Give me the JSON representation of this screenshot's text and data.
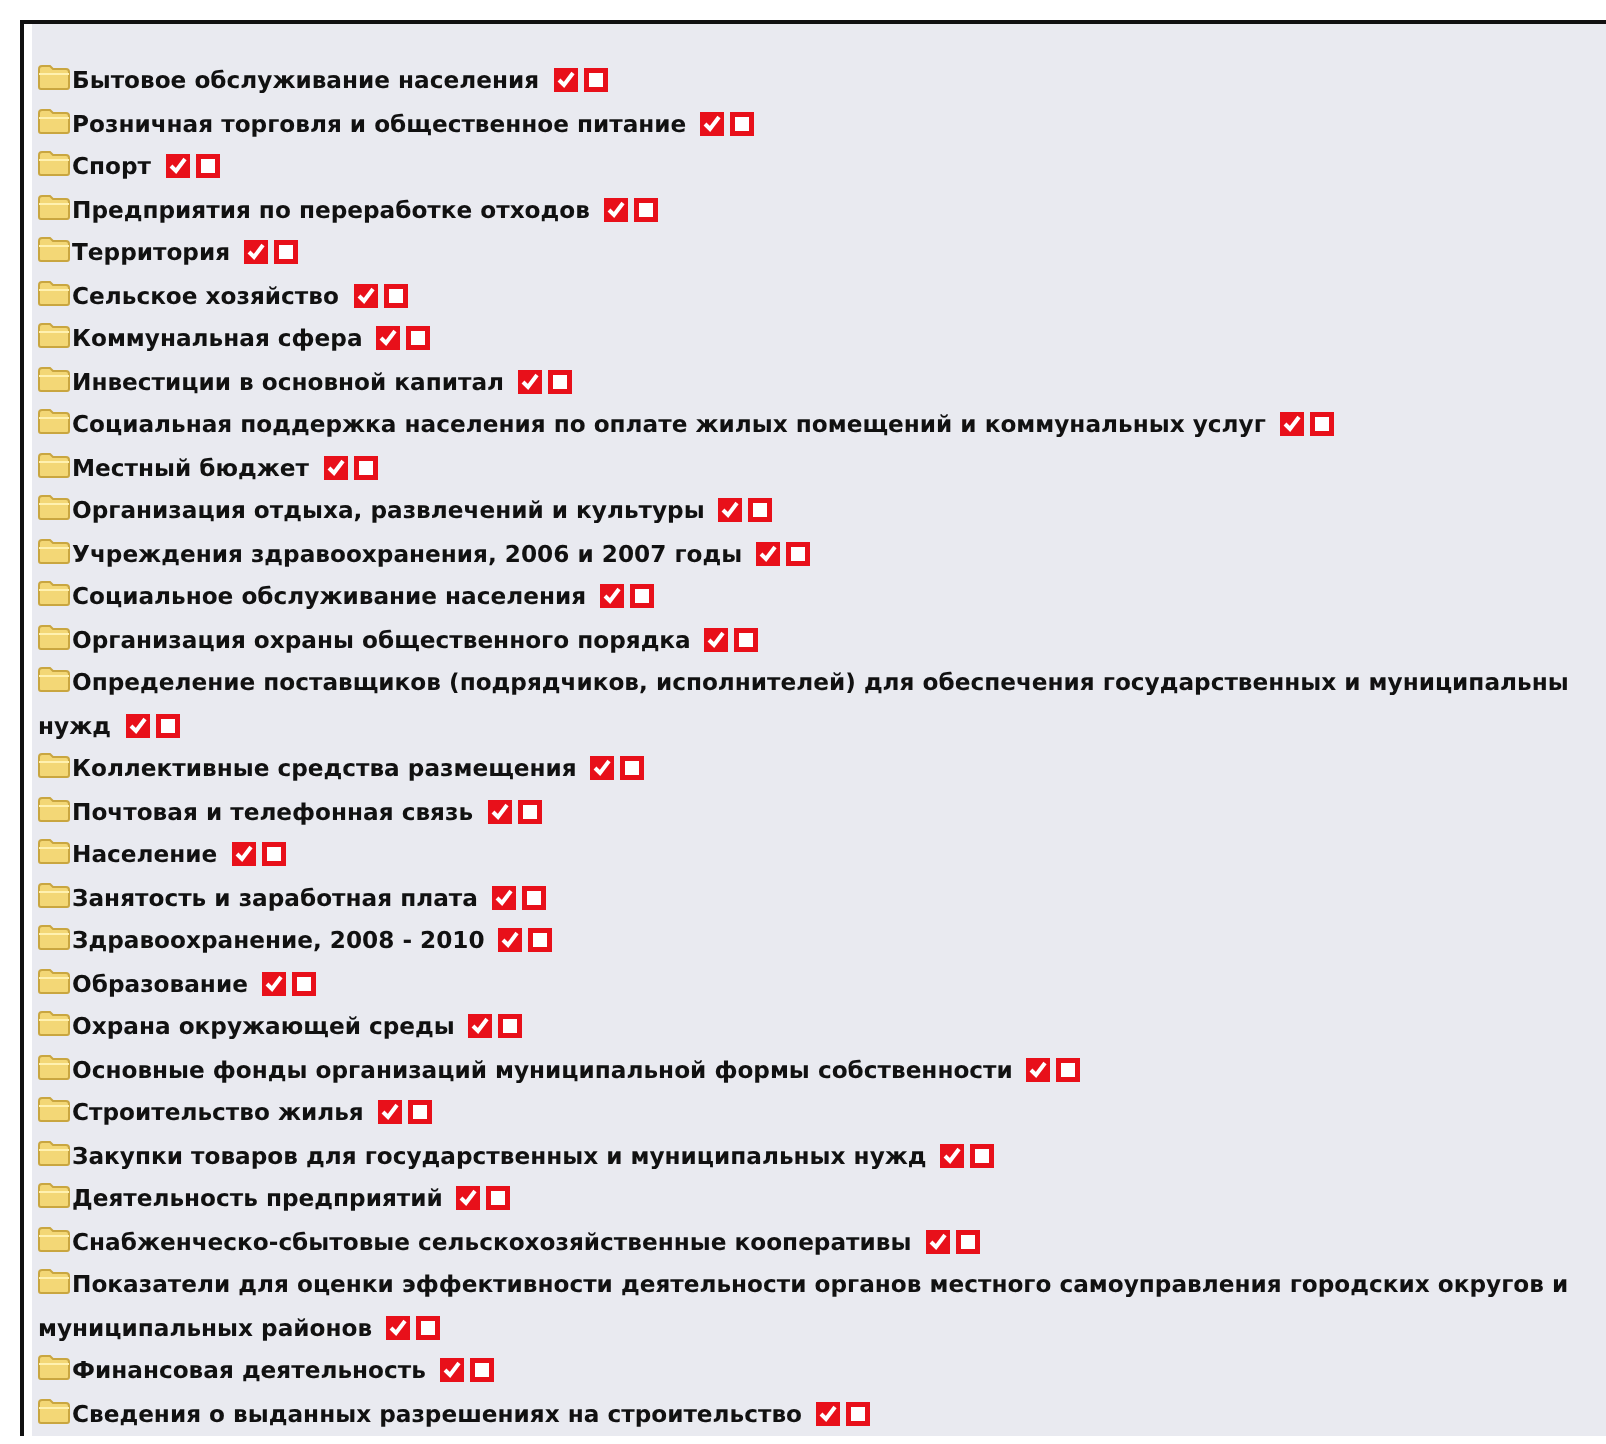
{
  "items": [
    {
      "text": "Бытовое обслуживание населения"
    },
    {
      "text": "Розничная торговля и общественное питание"
    },
    {
      "text": "Спорт"
    },
    {
      "text": "Предприятия по переработке отходов"
    },
    {
      "text": "Территория"
    },
    {
      "text": "Сельское хозяйство"
    },
    {
      "text": "Коммунальная сфера"
    },
    {
      "text": "Инвестиции в основной капитал"
    },
    {
      "text": "Социальная поддержка населения по оплате жилых помещений и коммунальных услуг"
    },
    {
      "text": "Местный бюджет"
    },
    {
      "text": "Организация отдыха, развлечений и культуры"
    },
    {
      "text": "Учреждения здравоохранения, 2006 и 2007 годы"
    },
    {
      "text": "Социальное обслуживание населения"
    },
    {
      "text": "Организация охраны общественного порядка"
    },
    {
      "text": "Определение поставщиков (подрядчиков, исполнителей) для обеспечения государственных и муниципальны",
      "text_2": "нужд"
    },
    {
      "text": "Коллективные средства размещения"
    },
    {
      "text": "Почтовая и телефонная связь"
    },
    {
      "text": "Население"
    },
    {
      "text": "Занятость и заработная плата"
    },
    {
      "text": "Здравоохранение, 2008 - 2010"
    },
    {
      "text": "Образование"
    },
    {
      "text": "Охрана окружающей среды"
    },
    {
      "text": "Основные фонды организаций муниципальной формы собственности"
    },
    {
      "text": "Строительство жилья"
    },
    {
      "text": "Закупки товаров для государственных и муниципальных нужд"
    },
    {
      "text": "Деятельность предприятий"
    },
    {
      "text": "Снабженческо-сбытовые сельскохозяйственные кооперативы"
    },
    {
      "text": "Показатели для оценки эффективности деятельности органов местного самоуправления городских округов и",
      "text_2": "муниципальных районов"
    },
    {
      "text": "Финансовая деятельность"
    },
    {
      "text": "Сведения о выданных разрешениях на строительство"
    }
  ]
}
